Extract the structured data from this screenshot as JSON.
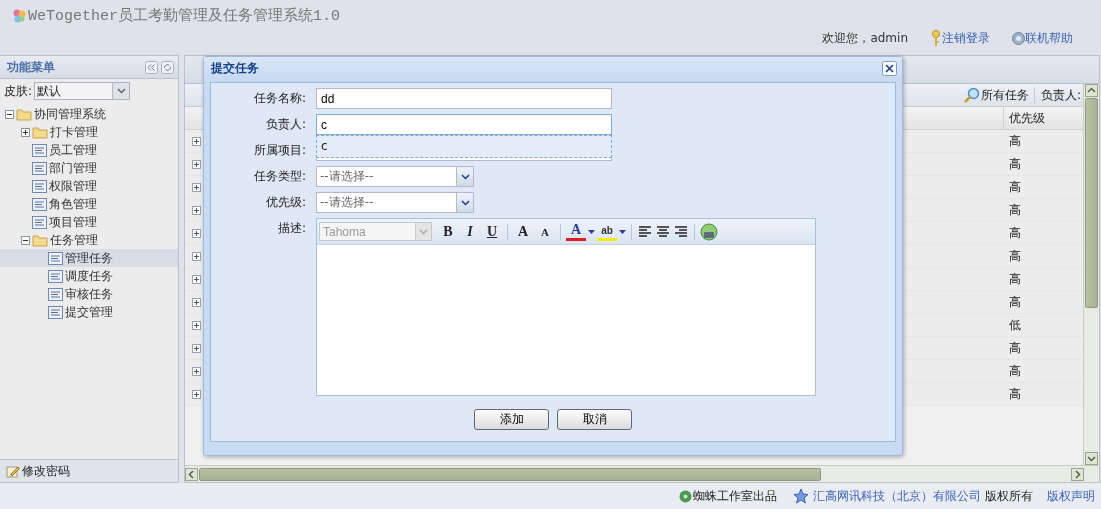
{
  "header": {
    "title": "WeTogether员工考勤管理及任务管理系统1.0",
    "welcome": "欢迎您，admin",
    "logout": "注销登录",
    "help": "联机帮助"
  },
  "sidebar": {
    "title": "功能菜单",
    "skin_label": "皮肤:",
    "skin_value": "默认",
    "tree": [
      {
        "label": "协同管理系统",
        "kind": "folder",
        "expanded": true,
        "selected": false,
        "children": [
          {
            "label": "打卡管理",
            "kind": "folder",
            "expanded": false,
            "selected": false
          },
          {
            "label": "员工管理",
            "kind": "page",
            "selected": false
          },
          {
            "label": "部门管理",
            "kind": "page",
            "selected": false
          },
          {
            "label": "权限管理",
            "kind": "page",
            "selected": false
          },
          {
            "label": "角色管理",
            "kind": "page",
            "selected": false
          },
          {
            "label": "项目管理",
            "kind": "page",
            "selected": false
          },
          {
            "label": "任务管理",
            "kind": "folder",
            "expanded": true,
            "selected": false,
            "children": [
              {
                "label": "管理任务",
                "kind": "page",
                "selected": true
              },
              {
                "label": "调度任务",
                "kind": "page",
                "selected": false
              },
              {
                "label": "审核任务",
                "kind": "page",
                "selected": false
              },
              {
                "label": "提交管理",
                "kind": "page",
                "selected": false
              }
            ]
          }
        ]
      }
    ],
    "bottom_link": "修改密码"
  },
  "grid": {
    "search_button": "所有任务",
    "assignee_label": "负责人:",
    "columns": [
      {
        "label": "优先级"
      }
    ],
    "rows": [
      {
        "priority": "高"
      },
      {
        "priority": "高"
      },
      {
        "priority": "高"
      },
      {
        "priority": "高"
      },
      {
        "priority": "高"
      },
      {
        "priority": "高"
      },
      {
        "priority": "高"
      },
      {
        "priority": "高"
      },
      {
        "priority": "低"
      },
      {
        "priority": "高"
      },
      {
        "priority": "高"
      },
      {
        "priority": "高"
      }
    ]
  },
  "dialog": {
    "title": "提交任务",
    "fields": [
      {
        "label": "任务名称:",
        "kind": "text",
        "value": "dd",
        "focused": false
      },
      {
        "label": "负责人:",
        "kind": "text",
        "value": "c",
        "focused": true,
        "suggestions": [
          "c"
        ]
      },
      {
        "label": "所属项目:",
        "kind": "text",
        "focused": false
      },
      {
        "label": "任务类型:",
        "kind": "select",
        "value": "--请选择--"
      },
      {
        "label": "优先级:",
        "kind": "select",
        "value": "--请选择--"
      }
    ],
    "editor": {
      "label": "描述:",
      "font": "Tahoma",
      "tools": [
        {
          "kind": "bold",
          "glyph": "B"
        },
        {
          "kind": "italic",
          "glyph": "I"
        },
        {
          "kind": "underline",
          "glyph": "U"
        },
        {
          "kind": "sep"
        },
        {
          "kind": "grow",
          "glyph": "A"
        },
        {
          "kind": "shrink",
          "glyph": "A"
        },
        {
          "kind": "sep"
        },
        {
          "kind": "forecolor",
          "glyph": "A"
        },
        {
          "kind": "highlight",
          "glyph": "ab"
        },
        {
          "kind": "sep"
        },
        {
          "kind": "align-left"
        },
        {
          "kind": "align-center"
        },
        {
          "kind": "align-right"
        },
        {
          "kind": "sep"
        },
        {
          "kind": "source"
        }
      ]
    },
    "buttons": [
      "添加",
      "取消"
    ]
  },
  "footer": {
    "studio": "蜘蛛工作室出品",
    "company": "汇高网讯科技（北京）有限公司",
    "rights": "版权所有",
    "notice": "版权声明"
  }
}
